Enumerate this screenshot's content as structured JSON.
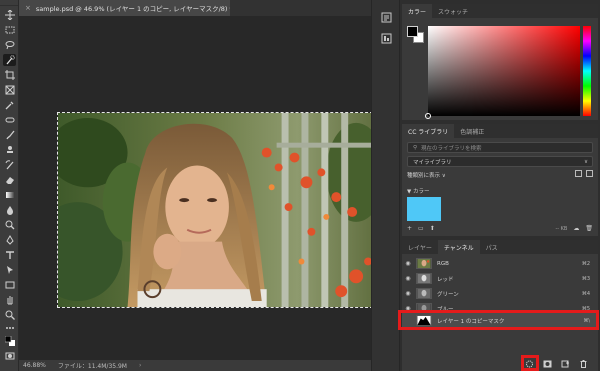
{
  "document": {
    "tab_close": "×",
    "tab_title": "sample.psd @ 46.9% (レイヤー 1 のコピー, レイヤーマスク/8) *"
  },
  "status": {
    "zoom": "46.88%",
    "file_info": "ファイル：11.4M/35.9M",
    "more": "›"
  },
  "color_panel": {
    "tabs": [
      "カラー",
      "スウォッチ"
    ],
    "foreground": "#000000",
    "background": "#ffffff"
  },
  "libraries_panel": {
    "tabs": [
      "CC ライブラリ",
      "色調補正"
    ],
    "search_placeholder": "現在のライブラリを検索",
    "library_select": "マイライブラリ",
    "sort_label": "種類別に表示 ∨",
    "group_label": "▼ カラー",
    "swatch_color": "#4fc8f7",
    "footer_kb": "-- KB"
  },
  "channels_panel": {
    "tabs": [
      "レイヤー",
      "チャンネル",
      "パス"
    ],
    "rows": [
      {
        "name": "RGB",
        "shortcut": "⌘2"
      },
      {
        "name": "レッド",
        "shortcut": "⌘3"
      },
      {
        "name": "グリーン",
        "shortcut": "⌘4"
      },
      {
        "name": "ブルー",
        "shortcut": "⌘5"
      },
      {
        "name": "レイヤー 1 のコピーマスク",
        "shortcut": "⌘\\"
      }
    ],
    "highlight_color": "#e51b1b"
  }
}
